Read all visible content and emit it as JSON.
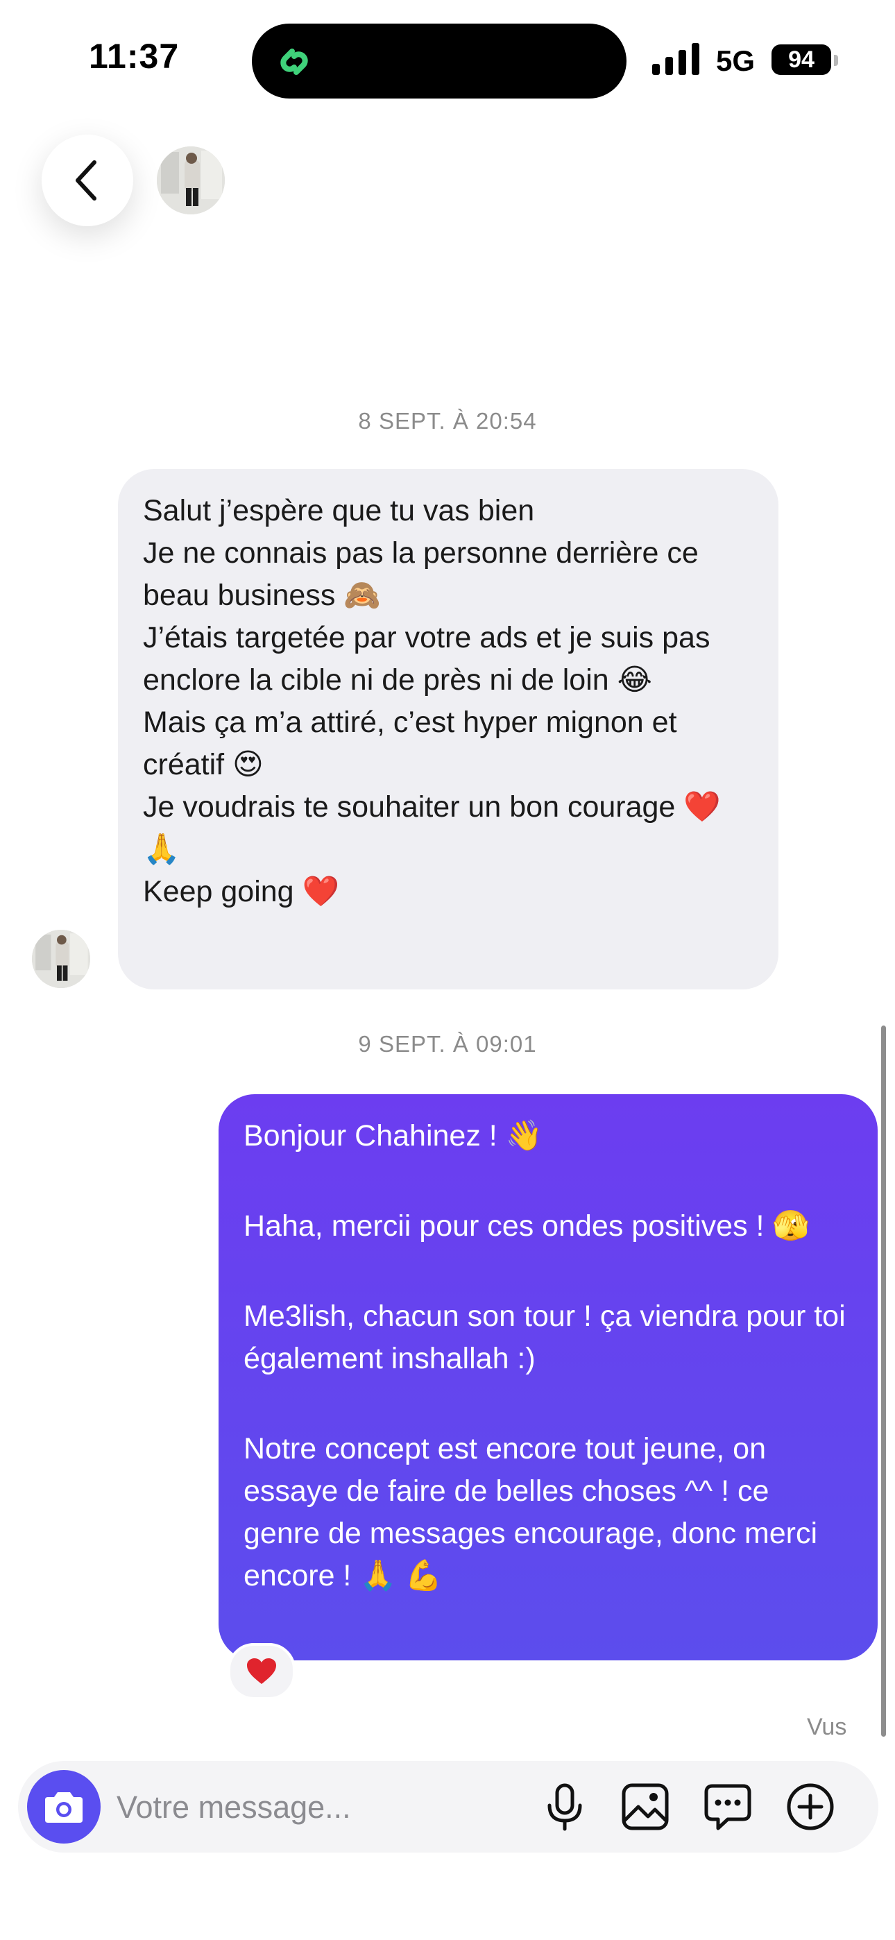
{
  "status_bar": {
    "time": "11:37",
    "network": "5G",
    "battery": "94"
  },
  "header": {
    "back_icon": "chevron-left-icon",
    "avatar_icon": "profile-photo"
  },
  "conversation": {
    "messages": [
      {
        "timestamp": "8 SEPT. À 20:54",
        "direction": "incoming",
        "lines": [
          "Salut j’espère que tu vas bien",
          "Je ne connais pas la personne derrière ce beau business 🙈",
          "J’étais targetée  par votre ads et je suis pas enclore la cible ni de près ni de loin 😂",
          "Mais ça m’a attiré, c’est hyper mignon et créatif 😍",
          "Je voudrais te souhaiter un bon courage ❤️ 🙏",
          "Keep going ❤️"
        ]
      },
      {
        "timestamp": "9 SEPT. À 09:01",
        "direction": "outgoing",
        "lines": [
          "Bonjour Chahinez ! 👋",
          "Haha, mercii pour ces ondes positives ! 🫣",
          "Me3lish, chacun son tour ! ça viendra pour toi également inshallah :)",
          "Notre concept est encore tout jeune, on essaye de faire de belles choses ^^ ! ce genre de messages encourage, donc merci encore ! 🙏 💪"
        ],
        "reaction": "❤️",
        "read_receipt": "Vus"
      }
    ]
  },
  "composer": {
    "placeholder": "Votre message...",
    "value": ""
  },
  "colors": {
    "outgoing_bubble_top": "#6c3df0",
    "outgoing_bubble_bottom": "#5c4ded",
    "incoming_bubble": "#efeff3",
    "camera_button": "#5a4ef0",
    "timestamp_text": "#8b8b8b"
  },
  "icons": [
    "signal-icon",
    "battery-icon",
    "chevron-left-icon",
    "camera-icon",
    "microphone-icon",
    "image-icon",
    "chat-bubble-icon",
    "plus-circle-icon"
  ]
}
